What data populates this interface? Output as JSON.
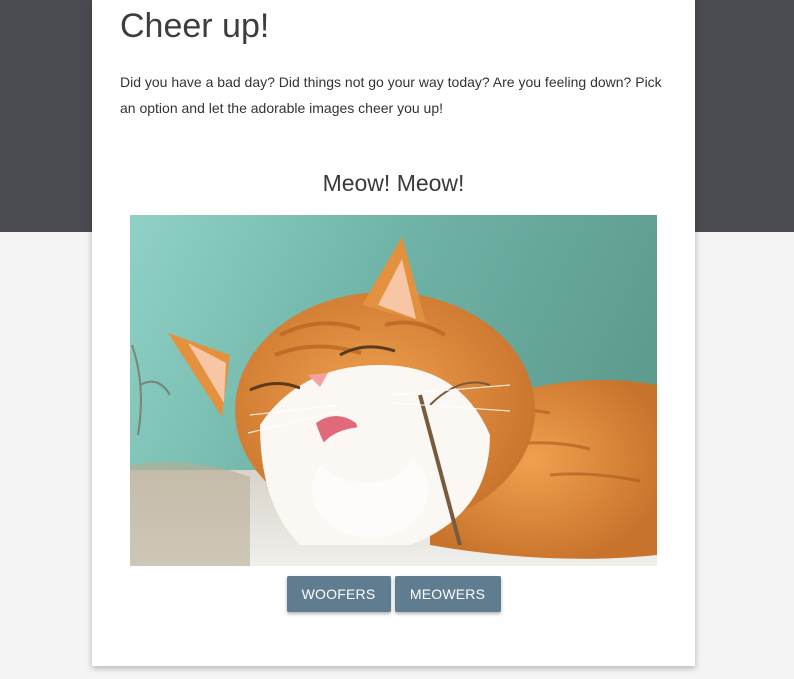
{
  "page": {
    "title": "Cheer up!",
    "intro": "Did you have a bad day? Did things not go your way today? Are you feeling down? Pick an option and let the adorable images cheer you up!"
  },
  "gallery": {
    "heading": "Meow! Meow!",
    "image_subject": "orange and white cat licking its paw"
  },
  "buttons": {
    "woofers_label": "WOOFERS",
    "meowers_label": "MEOWERS"
  },
  "colors": {
    "header_band": "#4a4b51",
    "page_background": "#f4f4f4",
    "card_background": "#ffffff",
    "button": "#5f7d8e",
    "button_text": "#ffffff",
    "photo_background": "#7bbdb2"
  }
}
